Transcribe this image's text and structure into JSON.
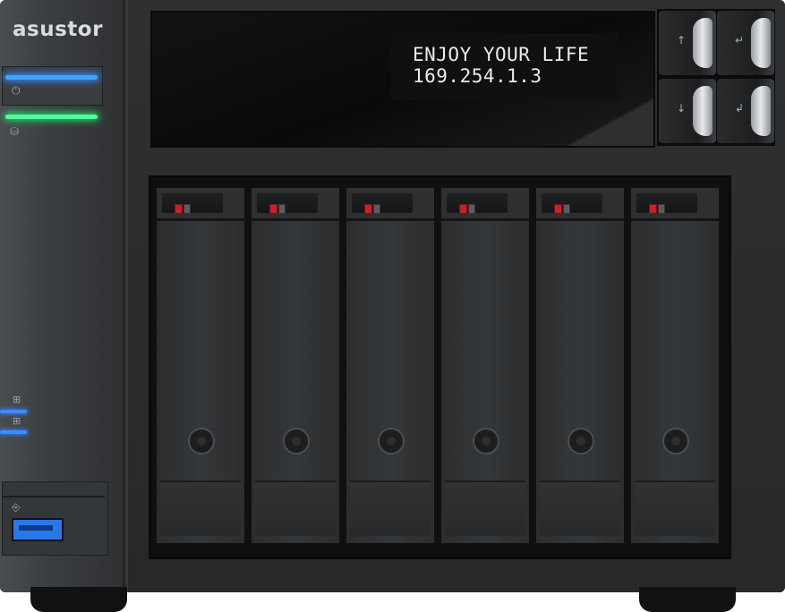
{
  "brand": {
    "logo_text": "asustor"
  },
  "lcd": {
    "line1": "ENJOY YOUR LIFE",
    "line2": "169.254.1.3"
  },
  "lcd_buttons": [
    {
      "name": "up",
      "glyph": "↑"
    },
    {
      "name": "back",
      "glyph": "↵"
    },
    {
      "name": "down",
      "glyph": "↓"
    },
    {
      "name": "enter",
      "glyph": "↲"
    }
  ],
  "indicators": {
    "power_led_color": "#3da4ff",
    "status_led_color": "#4dff9a",
    "lan_led_color": "#3d8cff",
    "drive_led_color": "#c9202a"
  },
  "drive_bays": [
    1,
    2,
    3,
    4,
    5,
    6
  ],
  "usb_port": {
    "type": "USB 3.0",
    "color": "#2a78e8"
  }
}
